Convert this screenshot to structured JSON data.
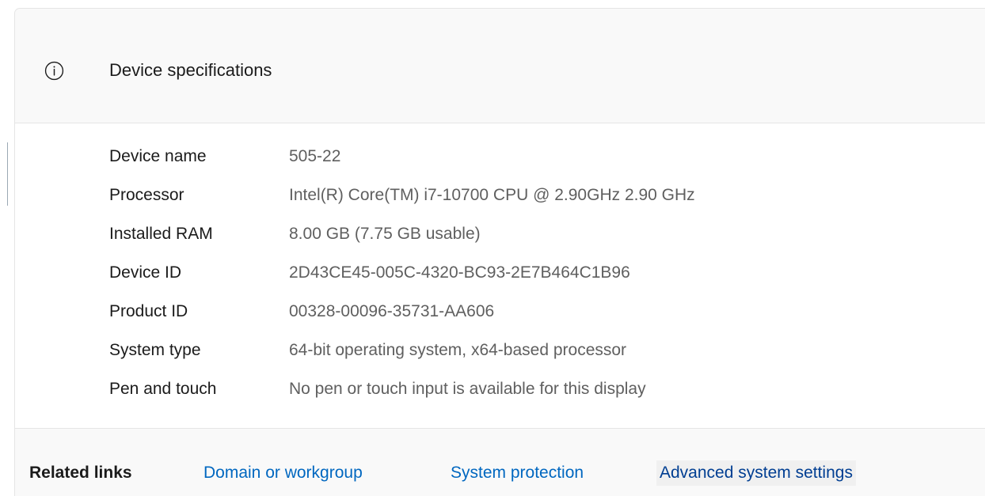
{
  "header": {
    "icon": "info-icon",
    "title": "Device specifications"
  },
  "specs": [
    {
      "label": "Device name",
      "value": "505-22"
    },
    {
      "label": "Processor",
      "value": "Intel(R) Core(TM) i7-10700 CPU @ 2.90GHz   2.90 GHz"
    },
    {
      "label": "Installed RAM",
      "value": "8.00 GB (7.75 GB usable)"
    },
    {
      "label": "Device ID",
      "value": "2D43CE45-005C-4320-BC93-2E7B464C1B96"
    },
    {
      "label": "Product ID",
      "value": "00328-00096-35731-AA606"
    },
    {
      "label": "System type",
      "value": "64-bit operating system, x64-based processor"
    },
    {
      "label": "Pen and touch",
      "value": "No pen or touch input is available for this display"
    }
  ],
  "related": {
    "label": "Related links",
    "links": [
      {
        "label": "Domain or workgroup"
      },
      {
        "label": "System protection"
      },
      {
        "label": "Advanced system settings"
      }
    ]
  },
  "colors": {
    "link": "#0067c0",
    "header_bg": "#f9f9f9",
    "text": "#1b1b1b",
    "value_text": "#5f5f5f"
  }
}
